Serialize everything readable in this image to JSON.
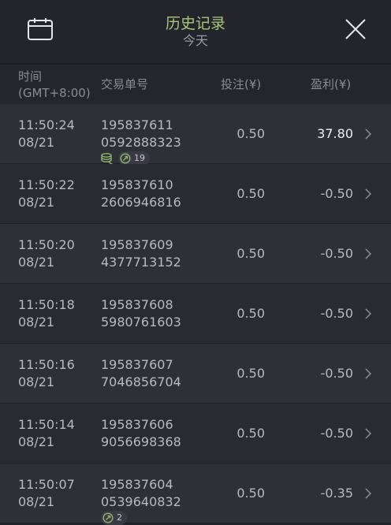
{
  "header": {
    "title": "历史记录",
    "subtitle": "今天"
  },
  "columns": {
    "time": "时间\n(GMT+8:00)",
    "id": "交易单号",
    "bet": "投注(¥)",
    "profit": "盈利(¥)"
  },
  "rows": [
    {
      "time": "11:50:24",
      "date": "08/21",
      "id_a": "195837611",
      "id_b": "0592888323",
      "bet": "0.50",
      "profit": "37.80",
      "coin_icon": true,
      "count": "19"
    },
    {
      "time": "11:50:22",
      "date": "08/21",
      "id_a": "195837610",
      "id_b": "2606946816",
      "bet": "0.50",
      "profit": "-0.50"
    },
    {
      "time": "11:50:20",
      "date": "08/21",
      "id_a": "195837609",
      "id_b": "4377713152",
      "bet": "0.50",
      "profit": "-0.50"
    },
    {
      "time": "11:50:18",
      "date": "08/21",
      "id_a": "195837608",
      "id_b": "5980761603",
      "bet": "0.50",
      "profit": "-0.50"
    },
    {
      "time": "11:50:16",
      "date": "08/21",
      "id_a": "195837607",
      "id_b": "7046856704",
      "bet": "0.50",
      "profit": "-0.50"
    },
    {
      "time": "11:50:14",
      "date": "08/21",
      "id_a": "195837606",
      "id_b": "9056698368",
      "bet": "0.50",
      "profit": "-0.50"
    },
    {
      "time": "11:50:07",
      "date": "08/21",
      "id_a": "195837604",
      "id_b": "0539640832",
      "bet": "0.50",
      "profit": "-0.35",
      "count": "2"
    }
  ],
  "icons": {
    "left": "calendar-icon",
    "right": "close-icon",
    "row": "chevron-right-icon"
  },
  "colors": {
    "title": "#a6c77a",
    "positive": "#f0f0f2",
    "badge": "#3a3a44"
  }
}
